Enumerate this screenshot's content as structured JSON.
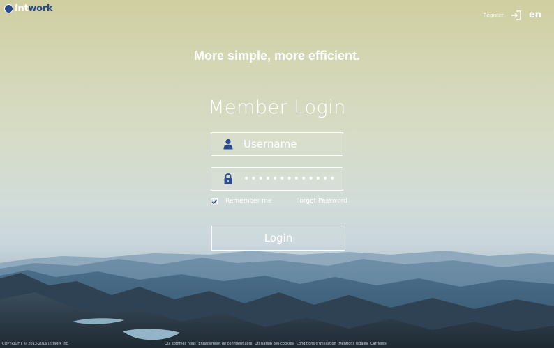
{
  "brand": {
    "logo_prefix": "Int",
    "logo_suffix": "work",
    "accent": "#2b4b8c"
  },
  "header": {
    "register_label": "Register",
    "register_icon": "sign-in-icon",
    "language": "en"
  },
  "hero": {
    "tagline": "More simple, more efficient."
  },
  "login": {
    "title": "Member Login",
    "username": {
      "placeholder": "Username",
      "value": "",
      "icon": "user-icon"
    },
    "password": {
      "placeholder": "",
      "value": "*************",
      "icon": "lock-icon"
    },
    "remember_me": {
      "label": "Remember me",
      "checked": true
    },
    "forgot_password": "Forgot Password",
    "submit": "Login"
  },
  "footer": {
    "copyright": "COPYRIGHT © 2013-2016 IntWork Inc.",
    "links": [
      "Qui sommes nous",
      "Engagement de confidentialite",
      "Utilisation des cookies",
      "Conditions d'utilisation",
      "Mentions legales",
      "Carrieres"
    ]
  }
}
